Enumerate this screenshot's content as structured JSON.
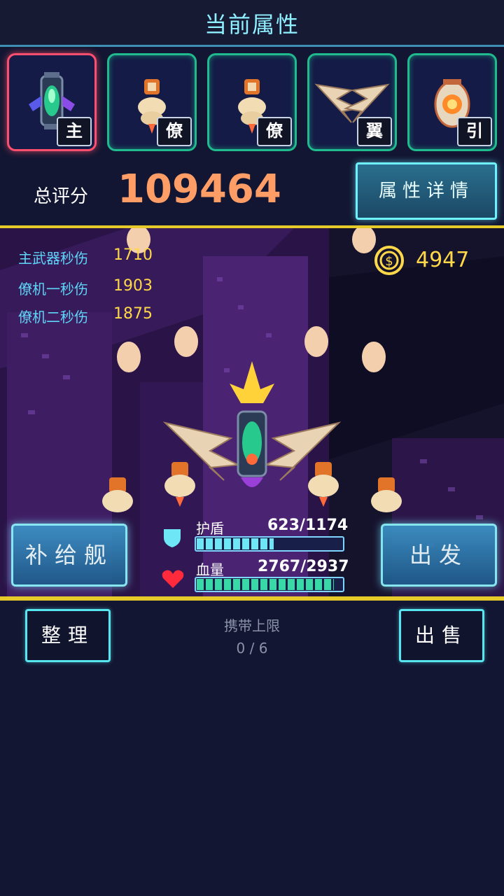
{
  "header": {
    "title": "当前属性"
  },
  "slots": [
    {
      "tag": "主",
      "icon": "main-weapon-icon",
      "selected": true
    },
    {
      "tag": "僚",
      "icon": "wingman-icon"
    },
    {
      "tag": "僚",
      "icon": "wingman-icon"
    },
    {
      "tag": "翼",
      "icon": "wing-icon"
    },
    {
      "tag": "引",
      "icon": "engine-icon"
    }
  ],
  "score": {
    "label": "总评分",
    "value": "109464"
  },
  "detail_button": "属性详情",
  "stats": [
    {
      "label": "主武器秒伤",
      "value": "1710"
    },
    {
      "label": "僚机一秒伤",
      "value": "1903"
    },
    {
      "label": "僚机二秒伤",
      "value": "1875"
    }
  ],
  "coins": {
    "icon": "coin-icon",
    "value": "4947"
  },
  "buttons": {
    "supply": "补给舰",
    "depart": "出发",
    "organize": "整理",
    "sell": "出售"
  },
  "shield": {
    "label": "护盾",
    "value": "623/1174",
    "ratio": 0.53,
    "color": "#6ee6f5",
    "icon": "shield-icon"
  },
  "health": {
    "label": "血量",
    "value": "2767/2937",
    "ratio": 0.94,
    "color": "#38d9a6",
    "icon": "heart-icon"
  },
  "inventory": {
    "label": "携带上限",
    "value": "0 / 6"
  },
  "colors": {
    "accent": "#8ff0ff",
    "score": "#ff9d66",
    "gold": "#ffd84a",
    "frame": "#e6ca2a"
  }
}
